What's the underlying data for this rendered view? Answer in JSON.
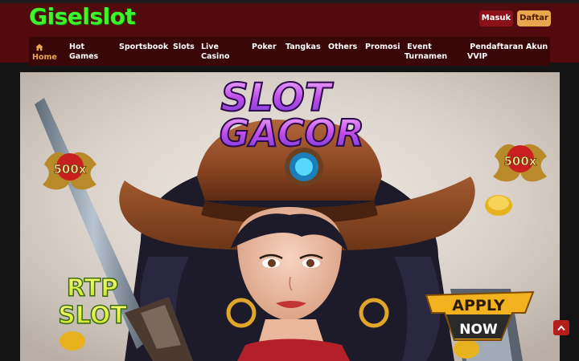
{
  "brand": {
    "logo_text": "Giselslot",
    "logo_color": "#3cf52a"
  },
  "header": {
    "login_label": "Masuk",
    "register_label": "Daftar"
  },
  "nav": {
    "items": [
      {
        "label": "Home",
        "icon": "home-icon",
        "active": true
      },
      {
        "label": "Hot\nGames"
      },
      {
        "label": "Sportsbook"
      },
      {
        "label": "Slots"
      },
      {
        "label": "Live\nCasino"
      },
      {
        "label": "Poker"
      },
      {
        "label": "Tangkas"
      },
      {
        "label": "Others"
      },
      {
        "label": "Promosi"
      },
      {
        "label": "Event\nTurnamen"
      },
      {
        "label": "Pendaftaran Akun\nVVIP"
      }
    ]
  },
  "banner": {
    "title_line1": "SLOT",
    "title_line2": "GACOR",
    "badge_left": "500x",
    "badge_right": "500x",
    "rtp_line1": "RTP",
    "rtp_line2": "SLOT",
    "cta_line1": "APPLY",
    "cta_line2": "NOW"
  },
  "colors": {
    "header_bg": "#520a0e",
    "nav_bg": "#3a0709",
    "accent": "#e9a64c",
    "login_btn": "#8c1018",
    "scroll_top_btn": "#b31d1d"
  },
  "icons": {
    "scroll_top": "chevron-up-icon"
  }
}
